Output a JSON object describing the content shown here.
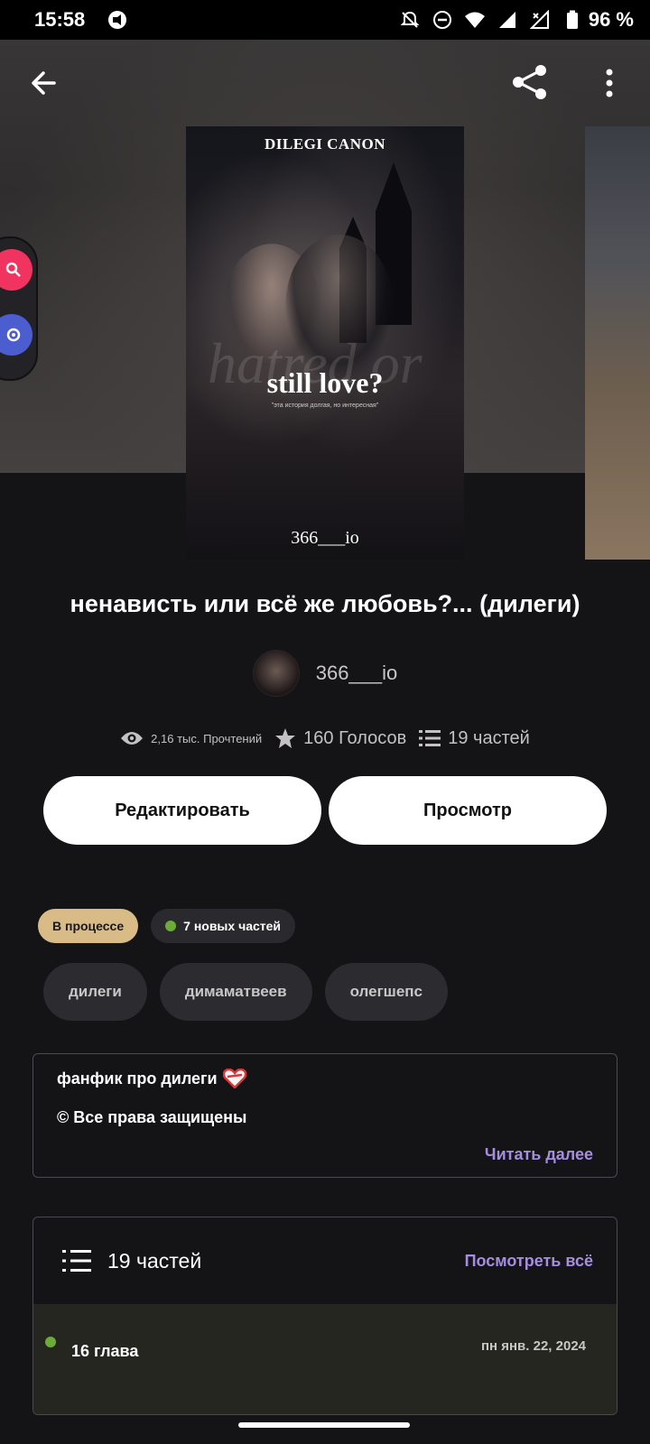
{
  "status_bar": {
    "time": "15:58",
    "battery": "96 %"
  },
  "toolbar": {
    "back_icon": "arrow-left-icon",
    "share_icon": "share-icon",
    "more_icon": "more-vertical-icon"
  },
  "cover": {
    "top_text": "DILEGI CANON",
    "main_text": "still love?",
    "watermark": "hatred or",
    "tagline": "\"эта история долгая, но интересная\"",
    "bottom_text": "366___io"
  },
  "story": {
    "title": "ненависть или всё же любовь?... (дилеги)",
    "author": "366___io",
    "reads": "2,16 тыс. Прочтений",
    "votes": "160 Голосов",
    "parts": "19 частей"
  },
  "actions": {
    "edit_label": "Редактировать",
    "view_label": "Просмотр"
  },
  "badges": {
    "status": "В процессе",
    "new_parts": "7 новых частей"
  },
  "tags": [
    "дилеги",
    "димаматвеев",
    "олегшепс"
  ],
  "description": {
    "line1": "фанфик про дилеги",
    "line2": "© Все права защищены",
    "read_more": "Читать далее"
  },
  "parts_card": {
    "count": "19 частей",
    "see_all": "Посмотреть всё",
    "latest_chapter": {
      "title": "16 глава",
      "date": "пн янв. 22, 2024"
    }
  },
  "colors": {
    "background": "#141316",
    "accent": "#a58ee0",
    "status_badge": "#d9bb87",
    "new_dot": "#6cab38"
  }
}
